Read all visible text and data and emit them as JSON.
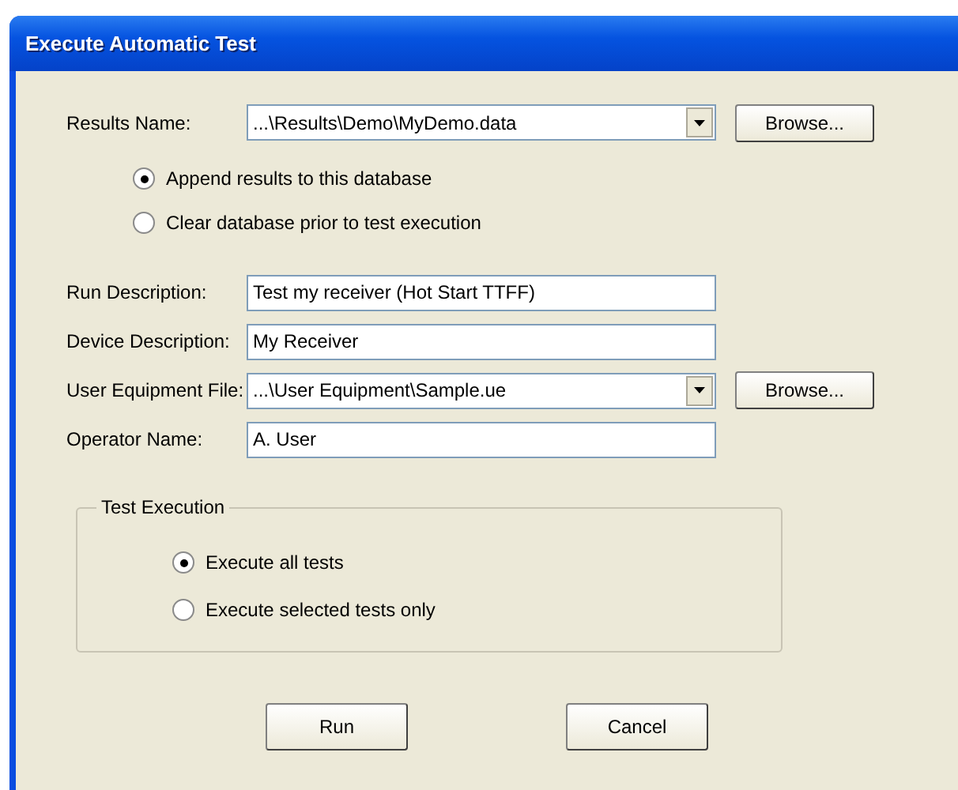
{
  "window": {
    "title": "Execute Automatic Test"
  },
  "results_name": {
    "label": "Results Name:",
    "value": "...\\Results\\Demo\\MyDemo.data",
    "browse": "Browse..."
  },
  "results_options": [
    {
      "label": "Append results to this database",
      "selected": true
    },
    {
      "label": "Clear database prior to test execution",
      "selected": false
    }
  ],
  "fields": [
    {
      "kind": "text",
      "label": "Run Description:",
      "value": "Test my receiver (Hot Start TTFF)"
    },
    {
      "kind": "text",
      "label": "Device Description:",
      "value": "My Receiver"
    },
    {
      "kind": "combo",
      "label": "User Equipment File:",
      "value": "...\\User Equipment\\Sample.ue",
      "browse": "Browse..."
    },
    {
      "kind": "text",
      "label": "Operator Name:",
      "value": "A. User"
    }
  ],
  "test_execution": {
    "title": "Test Execution",
    "options": [
      {
        "label": "Execute all tests",
        "selected": true
      },
      {
        "label": "Execute selected tests only",
        "selected": false
      }
    ]
  },
  "buttons": [
    "Run",
    "Cancel"
  ]
}
